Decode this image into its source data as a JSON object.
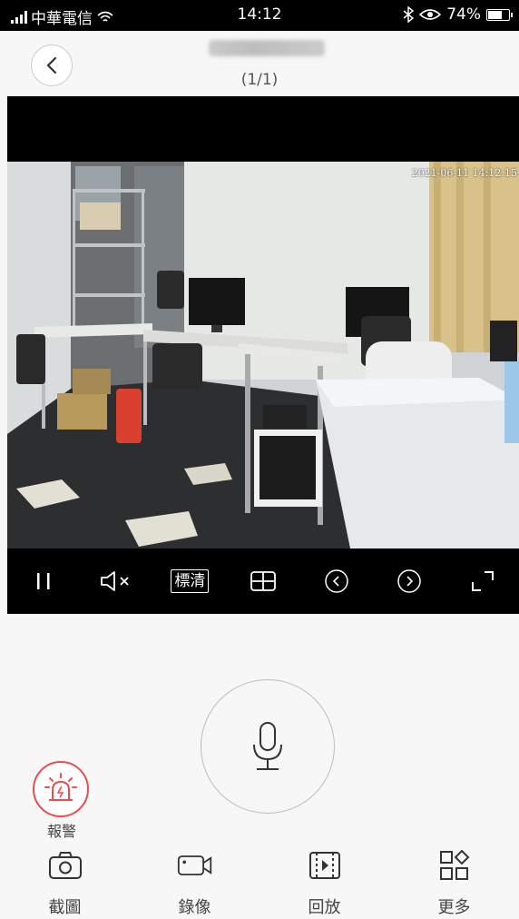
{
  "status_bar": {
    "carrier": "中華電信",
    "time": "14:12",
    "battery_percent": "74%",
    "battery_level": 0.74
  },
  "header": {
    "page_indicator": "(1/1)"
  },
  "video": {
    "osd_timestamp": "2021-06-11 14:12:15",
    "controls": {
      "pause_icon": "pause-icon",
      "mute_icon": "speaker-muted-icon",
      "quality_label": "標清",
      "layout_icon": "grid-icon",
      "prev_icon": "chevron-left-circle-icon",
      "next_icon": "chevron-right-circle-icon",
      "fullscreen_icon": "fullscreen-icon"
    }
  },
  "talk": {
    "icon": "microphone-icon"
  },
  "alarm": {
    "label": "報警",
    "color": "#f04b4b"
  },
  "toolbar": {
    "items": [
      {
        "label": "截圖",
        "icon": "camera-icon"
      },
      {
        "label": "錄像",
        "icon": "video-camera-icon"
      },
      {
        "label": "回放",
        "icon": "playback-icon"
      },
      {
        "label": "更多",
        "icon": "more-apps-icon"
      }
    ]
  }
}
